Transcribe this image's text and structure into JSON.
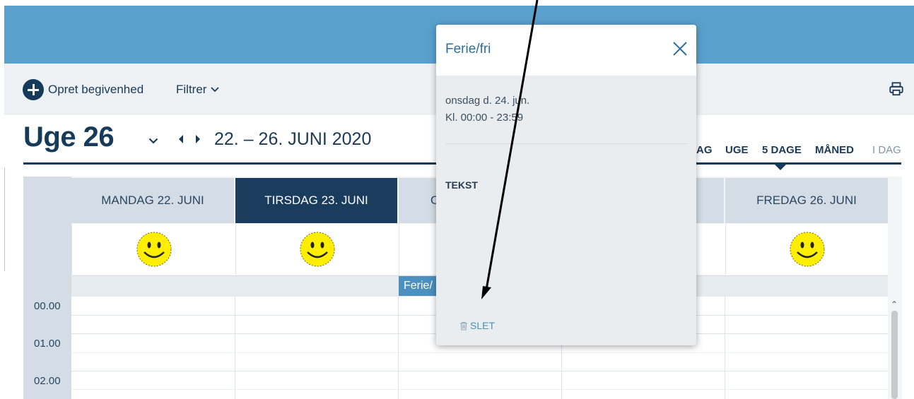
{
  "toolbar": {
    "create_label": "Opret begivenhed",
    "filter_label": "Filtrer"
  },
  "header": {
    "week_title": "Uge 26",
    "date_range": "22. – 26. JUNI 2020"
  },
  "view_tabs": [
    "AG",
    "UGE",
    "5 DAGE",
    "MÅNED",
    "I DAG"
  ],
  "days": [
    {
      "label": "MANDAG 22. JUNI",
      "active": false,
      "emoji": true
    },
    {
      "label": "TIRSDAG 23. JUNI",
      "active": true,
      "emoji": true
    },
    {
      "label": "O",
      "active": false,
      "emoji": false
    },
    {
      "label": "",
      "active": false,
      "emoji": false
    },
    {
      "label": "FREDAG 26. JUNI",
      "active": false,
      "emoji": true
    }
  ],
  "allday_event": "Ferie/",
  "times": [
    "00.00",
    "01.00",
    "02.00"
  ],
  "popup": {
    "title": "Ferie/fri",
    "date": "onsdag d. 24. jun.",
    "time": "Kl. 00:00 - 23:59",
    "section_label": "TEKST",
    "delete_label": "SLET"
  },
  "colors": {
    "topbar": "#5aa0cc",
    "navy": "#163a5a",
    "event": "#4c90bf",
    "popup_title": "#2f6f9b"
  },
  "icons": [
    "plus-circle-icon",
    "chevron-down-icon",
    "chevron-left-icon",
    "chevron-right-icon",
    "printer-icon",
    "close-icon",
    "trash-icon",
    "smiley-icon"
  ]
}
